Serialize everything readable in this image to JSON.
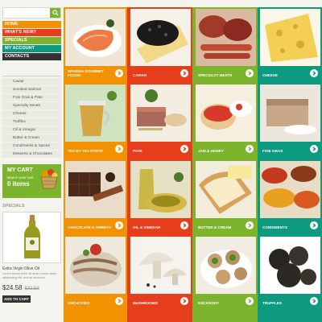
{
  "colors": {
    "orange": "#f39200",
    "red": "#e63d1c",
    "green": "#7cb52d",
    "teal": "#0d9a80",
    "dark": "#333333"
  },
  "search": {
    "icon": "search-icon"
  },
  "nav": {
    "items": [
      "HOME",
      "WHAT'S NEW?",
      "SPECIALS",
      "MY ACCOUNT",
      "CONTACTS"
    ]
  },
  "categories": {
    "items": [
      "Caviar",
      "Smoked Salmon",
      "Foie Gras & Pate",
      "Specialty Meats",
      "Cheese",
      "Truffles",
      "Oil & Vinegar",
      "Butter & Cream",
      "Condiments & Spices",
      "Desserts & Chocolates"
    ]
  },
  "cart": {
    "title": "MY CART",
    "subtitle": "Now in your cart",
    "count": "0 items"
  },
  "specials": {
    "heading": "SPECIALS",
    "product_name": "Extra Virgin Olive Oil",
    "product_desc": "Lorem ipsum dolor sit amet conse ctetur adipisicing elit, sed do eiusmod",
    "price": "$24.58",
    "old_price": "$32.58",
    "button": "ADD TO CART"
  },
  "tiles": [
    {
      "label": "SPANISH GOURMET FOODS"
    },
    {
      "label": "CAVIAR"
    },
    {
      "label": "SPECIALTY MEATS"
    },
    {
      "label": "CHEESE"
    },
    {
      "label": "TEA BY TEA FORTE"
    },
    {
      "label": "PATE"
    },
    {
      "label": "JAM & HONEY"
    },
    {
      "label": "FOIE GRAS"
    },
    {
      "label": "CHOCOLATE & SWEETS"
    },
    {
      "label": "OIL & VINEGAR"
    },
    {
      "label": "BUTTER & CREAM"
    },
    {
      "label": "CONDIMENTS"
    },
    {
      "label": "ANCHOVIES"
    },
    {
      "label": "MUSHROOMS"
    },
    {
      "label": "ESCARGOT"
    },
    {
      "label": "TRUFFLES"
    }
  ]
}
